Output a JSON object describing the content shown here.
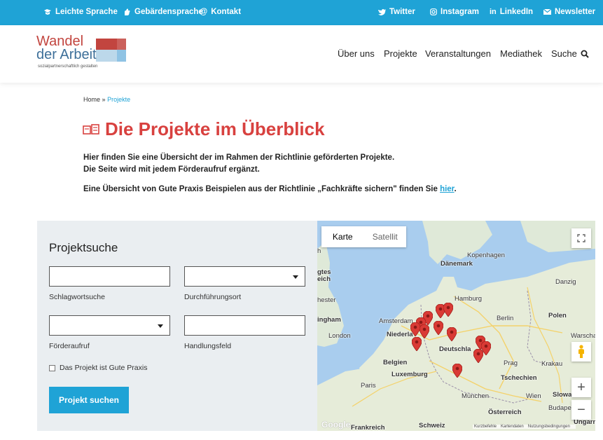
{
  "topbar": {
    "leichte_sprache": "Leichte Sprache",
    "gebaerdensprache": "Gebärdensprache",
    "kontakt": "Kontakt",
    "twitter": "Twitter",
    "instagram": "Instagram",
    "linkedin": "LinkedIn",
    "newsletter": "Newsletter"
  },
  "logo": {
    "line1": "Wandel",
    "line2": "der Arbeit",
    "tagline": "sozialpartnerschaftlich gestalten"
  },
  "nav": {
    "items": [
      "Über uns",
      "Projekte",
      "Veranstaltungen",
      "Mediathek",
      "Suche"
    ]
  },
  "breadcrumb": {
    "home": "Home",
    "sep": "»",
    "current": "Projekte"
  },
  "page": {
    "title": "Die Projekte im Überblick",
    "intro1": "Hier finden Sie eine Übersicht der im Rahmen der Richtlinie geförderten Projekte.",
    "intro2": "Die Seite wird mit jedem Förderaufruf ergänzt.",
    "intro3": "Eine Übersicht von Gute Praxis Beispielen aus der Richtlinie „Fachkräfte sichern\" finden Sie ",
    "intro3_link": "hier",
    "intro3_end": "."
  },
  "search": {
    "heading": "Projektsuche",
    "schlagwort_label": "Schlagwortsuche",
    "schlagwort_value": "",
    "ort_label": "Durchführungsort",
    "ort_value": "",
    "foerderaufruf_label": "Förderaufruf",
    "foerderaufruf_value": "",
    "handlungsfeld_label": "Handlungsfeld",
    "handlungsfeld_value": "",
    "gute_praxis_label": "Das Projekt ist Gute Praxis",
    "gute_praxis_checked": false,
    "button": "Projekt suchen"
  },
  "map": {
    "tab_map": "Karte",
    "tab_satellite": "Satellit",
    "active_tab": "Karte",
    "labels": {
      "kopenhagen": "Kopenhagen",
      "daenemark": "Dänemark",
      "danzig": "Danzig",
      "hamburg": "Hamburg",
      "berlin": "Berlin",
      "polen": "Polen",
      "warschau": "Warscha",
      "amsterdam": "Amsterdam",
      "niederlande": "Niederla",
      "london": "London",
      "deutschland": "Deutschla",
      "belgien": "Belgien",
      "luxemburg": "Luxemburg",
      "prag": "Prag",
      "krakau": "Krakau",
      "tschechien": "Tschechien",
      "paris": "Paris",
      "muenchen": "München",
      "wien": "Wien",
      "slowakei": "Slowa",
      "budapest": "Budape",
      "oesterreich": "Österreich",
      "schweiz": "Schweiz",
      "frankreich": "Frankreich",
      "ungarn": "Ungarn",
      "gtes": "gtes",
      "eich": "eich",
      "hester": "hester",
      "ingham": "ingham",
      "h": "h"
    },
    "google": "Google",
    "attribution": [
      "Kurzbefehle",
      "Kartendaten",
      "Nutzungsbedingungen"
    ],
    "zoom_in": "+",
    "zoom_out": "−"
  },
  "colors": {
    "brand_blue": "#1fa3d6",
    "title_red": "#d8413f",
    "pin_red": "#d93a35"
  }
}
